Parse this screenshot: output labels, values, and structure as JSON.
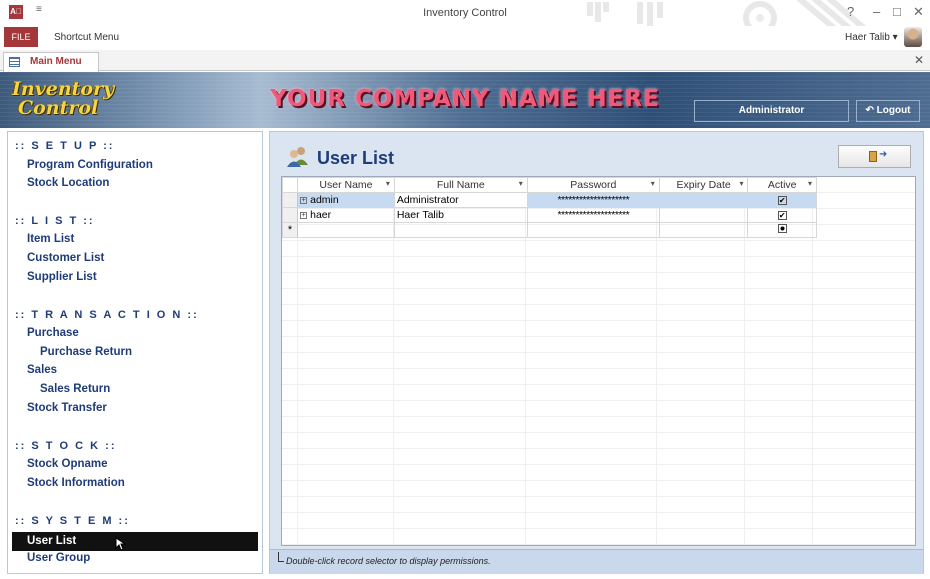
{
  "window": {
    "title": "Inventory Control",
    "app_icon": "A⃣",
    "qat": "≡",
    "help": "?",
    "minimize": "–",
    "maximize": "□",
    "close": "✕"
  },
  "ribbon": {
    "file_tab": "FILE",
    "shortcut_tab": "Shortcut Menu",
    "user_name": "Haer Talib",
    "user_dropdown": "▾"
  },
  "doc_tabs": {
    "tabs": [
      {
        "label": "Main Menu"
      }
    ],
    "close": "✕"
  },
  "header": {
    "logo_line1": "Inventory",
    "logo_line2": "Control",
    "company": "YOUR COMPANY NAME HERE",
    "user_role": "Administrator",
    "logout_label": "↶ Logout"
  },
  "sidebar": {
    "sections": [
      {
        "title": ":: S E T U P ::",
        "items": [
          "Program Configuration",
          "Stock Location"
        ]
      },
      {
        "title": ":: L I S T ::",
        "items": [
          "Item List",
          "Customer List",
          "Supplier List"
        ]
      },
      {
        "title": ":: T R A N S A C T I O N ::",
        "items": [
          "Purchase",
          "Purchase Return",
          "Sales",
          "Sales Return",
          "Stock Transfer"
        ]
      },
      {
        "title": ":: S T O C K ::",
        "items": [
          "Stock Opname",
          "Stock Information"
        ]
      },
      {
        "title": ":: S Y S T E M ::",
        "items": [
          "User List",
          "User Group"
        ]
      }
    ],
    "active_item": "User List"
  },
  "main": {
    "title": "User List",
    "columns": [
      "User Name",
      "Full Name",
      "Password",
      "Expiry Date",
      "Active"
    ],
    "sort_glyph": "▾",
    "rows": [
      {
        "expand": "+",
        "user_name": "admin",
        "full_name": "Administrator",
        "password": "********************",
        "expiry_date": "",
        "active": "✔"
      },
      {
        "expand": "+",
        "user_name": "haer",
        "full_name": "Haer Talib",
        "password": "********************",
        "expiry_date": "",
        "active": "✔"
      }
    ],
    "new_row_marker": "*",
    "footer_note": "Double-click record selector to display permissions."
  },
  "colors": {
    "accent": "#a4373a",
    "navy_text": "#1f3c78",
    "panel_bg": "#dbe5f1",
    "company_pink": "#f05a7a",
    "logo_gold": "#f3d547"
  }
}
